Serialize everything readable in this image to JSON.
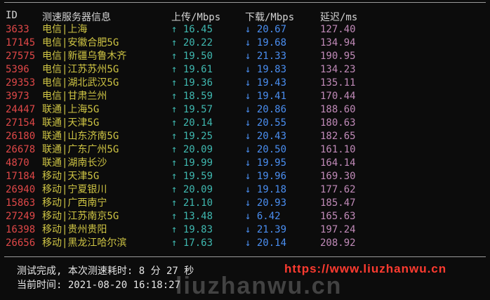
{
  "header": {
    "id": "ID",
    "server": "测速服务器信息",
    "upload": "上传/Mbps",
    "download": "下载/Mbps",
    "latency": "延迟/ms"
  },
  "rows": [
    {
      "id": "3633",
      "name": "电信|上海",
      "up": "↑ 16.45",
      "down": "↓ 20.67",
      "lat": "127.40"
    },
    {
      "id": "17145",
      "name": "电信|安徽合肥5G",
      "up": "↑ 20.22",
      "down": "↓ 19.68",
      "lat": "134.94"
    },
    {
      "id": "27575",
      "name": "电信|新疆乌鲁木齐",
      "up": "↑ 19.50",
      "down": "↓ 21.33",
      "lat": "190.95"
    },
    {
      "id": "5396",
      "name": "电信|江苏苏州5G",
      "up": "↑ 19.61",
      "down": "↓ 19.83",
      "lat": "134.23"
    },
    {
      "id": "29353",
      "name": "电信|湖北武汉5G",
      "up": "↑ 19.36",
      "down": "↓ 19.43",
      "lat": "135.11"
    },
    {
      "id": "3973",
      "name": "电信|甘肃兰州",
      "up": "↑ 18.59",
      "down": "↓ 19.41",
      "lat": "170.44"
    },
    {
      "id": "24447",
      "name": "联通|上海5G",
      "up": "↑ 19.57",
      "down": "↓ 20.86",
      "lat": "188.60"
    },
    {
      "id": "27154",
      "name": "联通|天津5G",
      "up": "↑ 20.14",
      "down": "↓ 20.55",
      "lat": "180.63"
    },
    {
      "id": "26180",
      "name": "联通|山东济南5G",
      "up": "↑ 19.25",
      "down": "↓ 20.43",
      "lat": "182.65"
    },
    {
      "id": "26678",
      "name": "联通|广东广州5G",
      "up": "↑ 20.09",
      "down": "↓ 20.50",
      "lat": "161.10"
    },
    {
      "id": "4870",
      "name": "联通|湖南长沙",
      "up": "↑ 19.99",
      "down": "↓ 19.95",
      "lat": "164.14"
    },
    {
      "id": "17184",
      "name": "移动|天津5G",
      "up": "↑ 19.59",
      "down": "↓ 19.96",
      "lat": "169.30"
    },
    {
      "id": "26940",
      "name": "移动|宁夏银川",
      "up": "↑ 20.09",
      "down": "↓ 19.18",
      "lat": "177.62"
    },
    {
      "id": "15863",
      "name": "移动|广西南宁",
      "up": "↑ 21.10",
      "down": "↓ 20.93",
      "lat": "185.47"
    },
    {
      "id": "27249",
      "name": "移动|江苏南京5G",
      "up": "↑ 13.48",
      "down": "↓ 6.42",
      "lat": "165.63"
    },
    {
      "id": "16398",
      "name": "移动|贵州贵阳",
      "up": "↑ 19.83",
      "down": "↓ 21.39",
      "lat": "197.24"
    },
    {
      "id": "26656",
      "name": "移动|黑龙江哈尔滨",
      "up": "↑ 17.63",
      "down": "↓ 20.14",
      "lat": "208.92"
    }
  ],
  "footer": {
    "line1": "测试完成, 本次测速耗时: 8 分 27 秒",
    "line2": "当前时间: 2021-08-20 16:18:27"
  },
  "watermark": "https://www.liuzhanwu.cn",
  "watermark2": "liuzhanwu.cn",
  "colors": {
    "background": "#0c0c0c",
    "id": "#e04848",
    "name": "#cfc544",
    "upload": "#3fb8b0",
    "download": "#4a8ef0",
    "latency": "#c08ab8",
    "watermark": "#ff3b30"
  }
}
